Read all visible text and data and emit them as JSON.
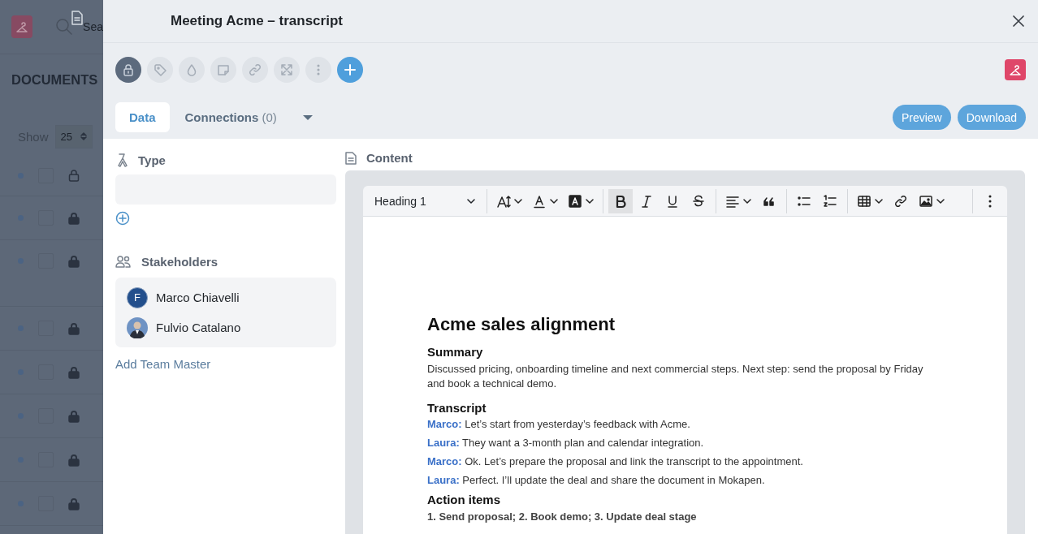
{
  "background": {
    "search_placeholder": "Sea",
    "title": "DOCUMENTS",
    "show_label": "Show",
    "page_size": "25",
    "rows": [
      {
        "checked": false
      },
      {
        "checked": false
      },
      {
        "checked": false
      },
      {
        "checked": false
      },
      {
        "checked": false
      },
      {
        "checked": false
      },
      {
        "checked": false
      },
      {
        "checked": false
      }
    ]
  },
  "panel": {
    "title": "Meeting Acme – transcript",
    "actions": [
      {
        "kind": "lock",
        "active": true
      },
      {
        "kind": "tag",
        "active": false
      },
      {
        "kind": "drop",
        "active": false
      },
      {
        "kind": "note",
        "active": false
      },
      {
        "kind": "link",
        "active": false
      },
      {
        "kind": "expand",
        "active": false
      },
      {
        "kind": "more",
        "active": false
      },
      {
        "kind": "add",
        "active": false
      }
    ],
    "tabs": [
      {
        "label": "Data",
        "selected": true
      },
      {
        "label": "Connections",
        "count": "(0)",
        "selected": false
      }
    ],
    "buttons": [
      "Preview",
      "Download"
    ],
    "type": {
      "label": "Type"
    },
    "stakeholders": {
      "label": "Stakeholders",
      "people": [
        {
          "name": "Marco Chiavelli",
          "kind": "initial",
          "initial": "F"
        },
        {
          "name": "Fulvio Catalano",
          "kind": "photo"
        }
      ],
      "add_link": "Add Team Master"
    },
    "content": {
      "label": "Content",
      "toolbar": {
        "block_style": "Heading 1",
        "tools": [
          {
            "kind": "font-size",
            "dropdown": true,
            "active": false
          },
          {
            "kind": "font-color",
            "dropdown": true,
            "active": false
          },
          {
            "kind": "highlight",
            "dropdown": true,
            "active": false
          },
          {
            "kind": "separator"
          },
          {
            "kind": "bold",
            "dropdown": false,
            "active": true
          },
          {
            "kind": "italic",
            "dropdown": false,
            "active": false
          },
          {
            "kind": "underline",
            "dropdown": false,
            "active": false
          },
          {
            "kind": "strike",
            "dropdown": false,
            "active": false
          },
          {
            "kind": "separator"
          },
          {
            "kind": "align",
            "dropdown": true,
            "active": false
          },
          {
            "kind": "quote",
            "dropdown": false,
            "active": false
          },
          {
            "kind": "separator"
          },
          {
            "kind": "bullets",
            "dropdown": false,
            "active": false
          },
          {
            "kind": "numbers",
            "dropdown": false,
            "active": false
          },
          {
            "kind": "separator"
          },
          {
            "kind": "table",
            "dropdown": true,
            "active": false
          },
          {
            "kind": "link",
            "dropdown": false,
            "active": false
          },
          {
            "kind": "image",
            "dropdown": true,
            "active": false
          },
          {
            "kind": "separator"
          },
          {
            "kind": "more",
            "dropdown": false,
            "active": false
          }
        ]
      },
      "document": {
        "title": "Acme sales alignment",
        "sections": [
          {
            "kind": "paragraph",
            "heading": "Summary",
            "text": "Discussed pricing, onboarding timeline and next commercial steps. Next step: send the proposal by Friday and book a technical demo."
          },
          {
            "kind": "dialogue",
            "heading": "Transcript",
            "lines": [
              {
                "speaker": "Marco:",
                "text": "Let’s start from yesterday’s feedback with Acme."
              },
              {
                "speaker": "Laura:",
                "text": "They want a 3-month plan and calendar integration."
              },
              {
                "speaker": "Marco:",
                "text": "Ok. Let’s prepare the proposal and link the transcript to the appointment."
              },
              {
                "speaker": "Laura:",
                "text": "Perfect. I’ll update the deal and share the document in Mokapen."
              }
            ]
          },
          {
            "kind": "list",
            "heading": "Action items",
            "text": "1. Send proposal; 2. Book demo; 3. Update deal stage"
          }
        ]
      }
    }
  }
}
